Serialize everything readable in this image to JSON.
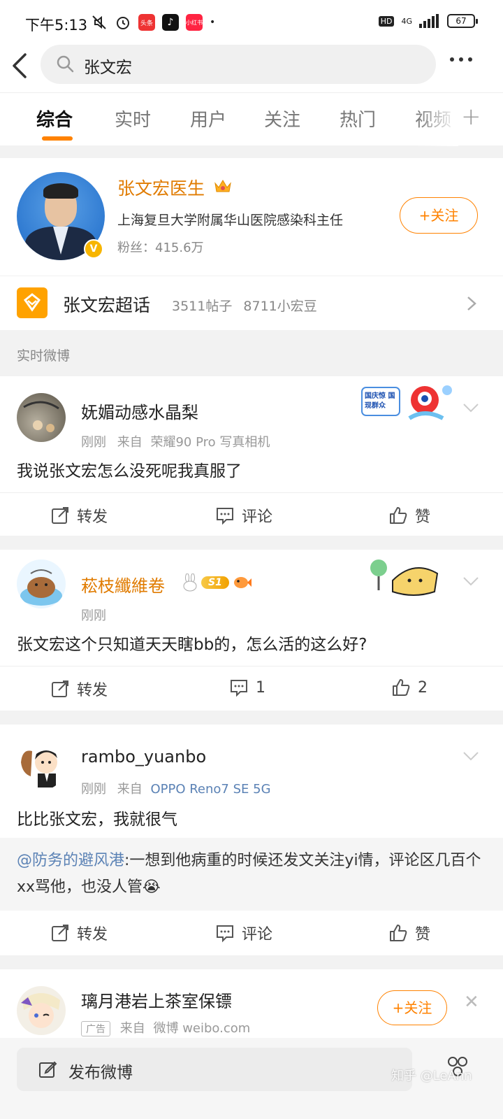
{
  "status_bar": {
    "time": "下午5:13",
    "app_icons": [
      "头条",
      "♪",
      "小红书"
    ],
    "network": "4G",
    "hd": "HD",
    "battery": "67"
  },
  "search": {
    "query": "张文宏"
  },
  "tabs": [
    {
      "label": "综合",
      "active": true
    },
    {
      "label": "实时",
      "active": false
    },
    {
      "label": "用户",
      "active": false
    },
    {
      "label": "关注",
      "active": false
    },
    {
      "label": "热门",
      "active": false
    },
    {
      "label": "视频",
      "active": false
    }
  ],
  "tab_plus": "+",
  "user_card": {
    "name": "张文宏医生",
    "description": "上海复旦大学附属华山医院感染科主任",
    "fans": "粉丝：415.6万",
    "follow_label": "+关注",
    "verified_badge": "V"
  },
  "super_topic": {
    "name": "张文宏超话",
    "posts": "3511帖子",
    "members": "8711小宏豆"
  },
  "section_label": "实时微博",
  "posts": [
    {
      "name": "妩媚动感水晶梨",
      "time": "刚刚",
      "source_prefix": "来自",
      "source": "荣耀90 Pro 写真相机",
      "text": "我说张文宏怎么没死呢我真服了",
      "repost": "转发",
      "comment": "评论",
      "like": "赞",
      "sticker": "国庆惊 国现群众"
    },
    {
      "name": "菘枝纖維卷",
      "time": "刚刚",
      "text": "张文宏这个只知道天天瞎bb的，怎么活的这么好?",
      "repost": "转发",
      "comment": "1",
      "like": "2",
      "level_badge": "S1"
    },
    {
      "name": "rambo_yuanbo",
      "time": "刚刚",
      "source_prefix": "来自",
      "source": "OPPO Reno7 SE 5G",
      "text": "比比张文宏，我就很气",
      "quote_user": "@防务的避风港",
      "quote_text": ":一想到他病重的时候还发文关注yi情，评论区几百个xx骂他，也没人管😭",
      "repost": "转发",
      "comment": "评论",
      "like": "赞"
    }
  ],
  "ad": {
    "name": "璃月港岩上茶室保镖",
    "ad_label": "广告",
    "source_prefix": "来自",
    "source": "微博 weibo.com",
    "follow_label": "+关注"
  },
  "bottom": {
    "compose_label": "发布微博",
    "watermark": "知乎 @LeAnn"
  },
  "colors": {
    "accent": "#ff8200",
    "vip_name": "#e07b00",
    "link": "#5b82b5"
  }
}
